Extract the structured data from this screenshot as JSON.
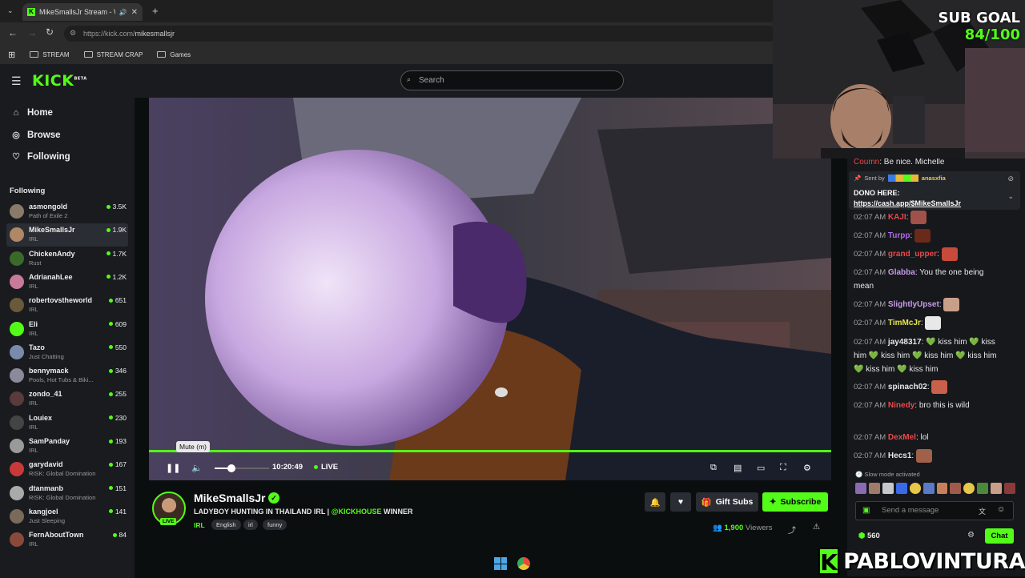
{
  "browser": {
    "tab_title": "MikeSmallsJr Stream - Watc",
    "url_domain": "https://kick.com/",
    "url_path": "mikesmallsjr",
    "bookmarks": [
      "STREAM",
      "STREAM CRAP",
      "Games"
    ]
  },
  "header": {
    "logo": "KICK",
    "logo_beta": "BETA",
    "search_placeholder": "Search"
  },
  "sidebar": {
    "nav": [
      {
        "label": "Home",
        "icon": "home-icon"
      },
      {
        "label": "Browse",
        "icon": "compass-icon"
      },
      {
        "label": "Following",
        "icon": "heart-icon"
      }
    ],
    "following_header": "Following",
    "channels": [
      {
        "name": "asmongold",
        "category": "Path of Exile 2",
        "viewers": "3.5K",
        "color": "#8a7a6a"
      },
      {
        "name": "MikeSmallsJr",
        "category": "IRL",
        "viewers": "1.9K",
        "color": "#b08866",
        "active": true
      },
      {
        "name": "ChickenAndy",
        "category": "Rust",
        "viewers": "1.7K",
        "color": "#3a6a2a"
      },
      {
        "name": "AdrianahLee",
        "category": "IRL",
        "viewers": "1.2K",
        "color": "#c87a9a"
      },
      {
        "name": "robertovstheworld",
        "category": "IRL",
        "viewers": "651",
        "color": "#6a5a3a"
      },
      {
        "name": "Eli",
        "category": "IRL",
        "viewers": "609",
        "color": "#53fc18"
      },
      {
        "name": "Tazo",
        "category": "Just Chatting",
        "viewers": "550",
        "color": "#7a8aaa"
      },
      {
        "name": "bennymack",
        "category": "Pools, Hot Tubs & Biki...",
        "viewers": "346",
        "color": "#8a8a9a"
      },
      {
        "name": "zondo_41",
        "category": "IRL",
        "viewers": "255",
        "color": "#5a3a3a"
      },
      {
        "name": "Louiex",
        "category": "IRL",
        "viewers": "230",
        "color": "#444"
      },
      {
        "name": "SamPanday",
        "category": "IRL",
        "viewers": "193",
        "color": "#9a9a9a"
      },
      {
        "name": "garydavid",
        "category": "RISK: Global Domination",
        "viewers": "167",
        "color": "#c83a3a"
      },
      {
        "name": "dtanmanb",
        "category": "RISK: Global Domination",
        "viewers": "151",
        "color": "#aaa"
      },
      {
        "name": "kangjoel",
        "category": "Just Sleeping",
        "viewers": "141",
        "color": "#7a6a5a"
      },
      {
        "name": "FernAboutTown",
        "category": "IRL",
        "viewers": "84",
        "color": "#8a4a3a"
      }
    ]
  },
  "player": {
    "tooltip": "Mute (m)",
    "time": "10:20:49",
    "live": "LIVE"
  },
  "stream": {
    "streamer": "MikeSmallsJr",
    "title_prefix": "LADYBOY HUNTING IN THAILAND IRL | ",
    "title_highlight": "@KICKHOUSE",
    "title_suffix": " WINNER",
    "live_badge": "LIVE",
    "category": "IRL",
    "tags": [
      "English",
      "irl",
      "funny"
    ],
    "gift_subs": "Gift Subs",
    "subscribe": "Subscribe",
    "viewer_count": "1,900",
    "viewers_label": "Viewers"
  },
  "overlay": {
    "sub_goal_label": "SUB GOAL",
    "sub_goal_value": "84/100",
    "watermark": "PABLOVINTURA",
    "watermark_k": "K"
  },
  "chat": {
    "top_partial": ": Be nice. Michelle",
    "top_partial_user": "Coumn",
    "pinned_sent_by": "Sent by",
    "pinned_user": "anasxfia",
    "pinned_line1": "DONO HERE:",
    "pinned_link": "https://cash.app/$MikeSmallsJr",
    "messages": [
      {
        "time": "02:07 AM",
        "user": "KAJI",
        "color": "#e84a4a",
        "text": "",
        "emote": "#a0524a"
      },
      {
        "time": "02:07 AM",
        "user": "Turpp",
        "color": "#b06ae8",
        "text": "",
        "emote": "#6a2a1a"
      },
      {
        "time": "02:07 AM",
        "user": "grand_upper",
        "color": "#e84a4a",
        "text": "",
        "emote": "#c84a3a"
      },
      {
        "time": "02:07 AM",
        "user": "Glabba",
        "color": "#c89ae8",
        "text": "You the one being mean"
      },
      {
        "time": "02:07 AM",
        "user": "SlightlyUpset",
        "color": "#c89ae8",
        "text": "",
        "emote": "#c8a08a"
      },
      {
        "time": "02:07 AM",
        "user": "TimMcJr",
        "color": "#e8e84a",
        "text": "",
        "emote": "#e8e8e8"
      },
      {
        "time": "02:07 AM",
        "user": "jay48317",
        "color": "#e8e8e8",
        "text": "💚 kiss him 💚 kiss him 💚 kiss him 💚 kiss him 💚 kiss him 💚 kiss him 💚 kiss him"
      },
      {
        "time": "02:07 AM",
        "user": "spinach02",
        "color": "#e8e8e8",
        "text": "",
        "emote": "#c8604a"
      },
      {
        "time": "02:07 AM",
        "user": "Ninedy",
        "color": "#e84a4a",
        "text": "bro this is wild"
      },
      {
        "time": "02:07 AM",
        "user": "DexMel",
        "color": "#e84a4a",
        "text": "lol"
      },
      {
        "time": "02:07 AM",
        "user": "Hecs1",
        "color": "#e8e8e8",
        "text": "",
        "emote": "#a0604a"
      }
    ],
    "slow_mode": "Slow mode activated",
    "input_placeholder": "Send a message",
    "points": "560",
    "chat_button": "Chat"
  }
}
